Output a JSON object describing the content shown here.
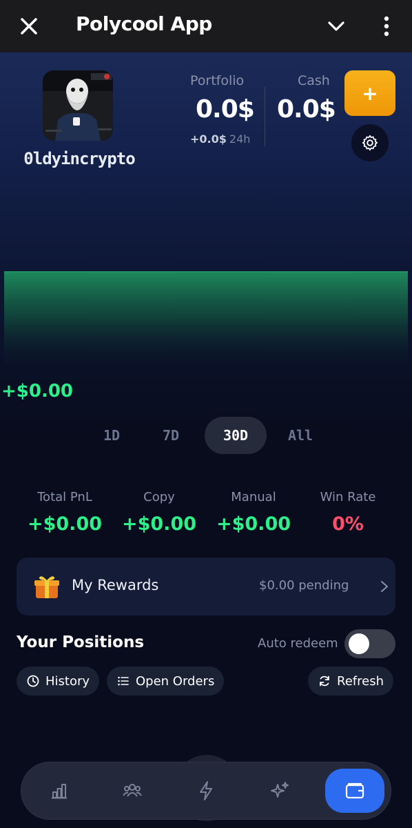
{
  "topbar": {
    "title": "Polycool App",
    "icons": [
      "close-icon",
      "chevron-down-icon",
      "more-vertical-icon"
    ]
  },
  "profile": {
    "username": "0ldyincrypto",
    "avatar": "avatar-image"
  },
  "portfolio": {
    "portfolio_label": "Portfolio",
    "portfolio_value": "0.0$",
    "cash_label": "Cash",
    "cash_value": "0.0$",
    "delta_value": "+0.0$",
    "delta_period": "24h",
    "add_label": "+",
    "settings_icon": "gear-icon"
  },
  "chart": {
    "pnl_value": "+$0.00",
    "accent_color": "#1f8f5e"
  },
  "chart_data": {
    "type": "area",
    "values": [
      0,
      0
    ],
    "title": "",
    "xlabel": "",
    "ylabel": "",
    "color": "#1f8f5e",
    "grid": false
  },
  "timeframes": {
    "items": [
      "1D",
      "7D",
      "30D",
      "All"
    ],
    "selected": "30D"
  },
  "metrics": {
    "total_pnl_label": "Total PnL",
    "total_pnl_value": "+$0.00",
    "copy_label": "Copy",
    "copy_value": "+$0.00",
    "manual_label": "Manual",
    "manual_value": "+$0.00",
    "win_rate_label": "Win Rate",
    "win_rate_value": "0%",
    "positive_color": "#2ef08a",
    "negative_color": "#ff4d6d"
  },
  "rewards": {
    "title": "My Rewards",
    "pending": "$0.00 pending",
    "icon": "gift-icon"
  },
  "positions": {
    "title": "Your Positions",
    "auto_redeem_label": "Auto redeem",
    "auto_redeem_on": false,
    "history_label": "History",
    "open_orders_label": "Open Orders",
    "refresh_label": "Refresh"
  },
  "nav": {
    "items": [
      "chart-bars-icon",
      "users-icon",
      "lightning-icon",
      "sparkles-icon",
      "wallet-icon"
    ],
    "active": "wallet-icon",
    "active_color": "#2d6bf0"
  }
}
